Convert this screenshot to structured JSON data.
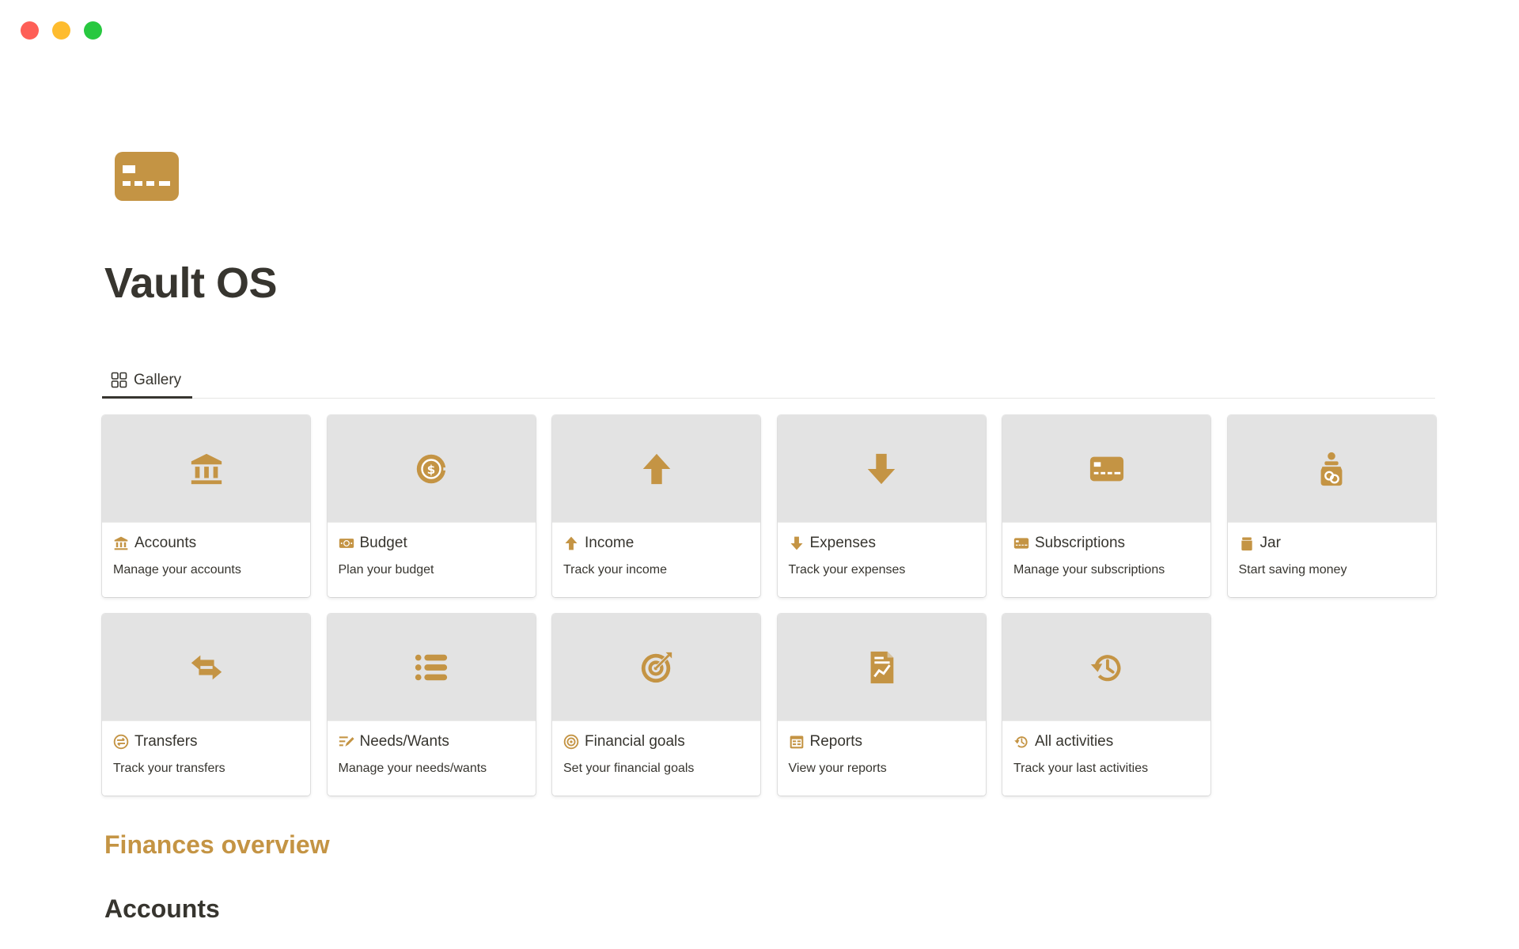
{
  "window": {
    "controls": [
      "close",
      "minimize",
      "zoom"
    ]
  },
  "page": {
    "title": "Vault OS",
    "icon": "credit-card-icon"
  },
  "colors": {
    "accent": "#c49444",
    "text": "#37352f",
    "cover": "#e3e3e3"
  },
  "view_tab": {
    "label": "Gallery",
    "icon": "gallery-grid-icon"
  },
  "cards": [
    {
      "title": "Accounts",
      "description": "Manage your accounts",
      "icon": "bank-icon"
    },
    {
      "title": "Budget",
      "description": "Plan your budget",
      "icon": "dollar-coin-icon"
    },
    {
      "title": "Income",
      "description": "Track your income",
      "icon": "arrow-up-icon"
    },
    {
      "title": "Expenses",
      "description": "Track your expenses",
      "icon": "arrow-down-icon"
    },
    {
      "title": "Subscriptions",
      "description": "Manage your subscriptions",
      "icon": "credit-card-icon"
    },
    {
      "title": "Jar",
      "description": "Start saving money",
      "icon": "jar-icon"
    },
    {
      "title": "Transfers",
      "description": "Track your transfers",
      "icon": "transfer-arrows-icon"
    },
    {
      "title": "Needs/Wants",
      "description": "Manage your needs/wants",
      "icon": "list-icon"
    },
    {
      "title": "Financial goals",
      "description": "Set your financial goals",
      "icon": "target-icon"
    },
    {
      "title": "Reports",
      "description": "View your reports",
      "icon": "report-icon"
    },
    {
      "title": "All activities",
      "description": "Track your last activities",
      "icon": "history-icon"
    }
  ],
  "sections": {
    "overview": "Finances overview",
    "accounts": "Accounts"
  }
}
